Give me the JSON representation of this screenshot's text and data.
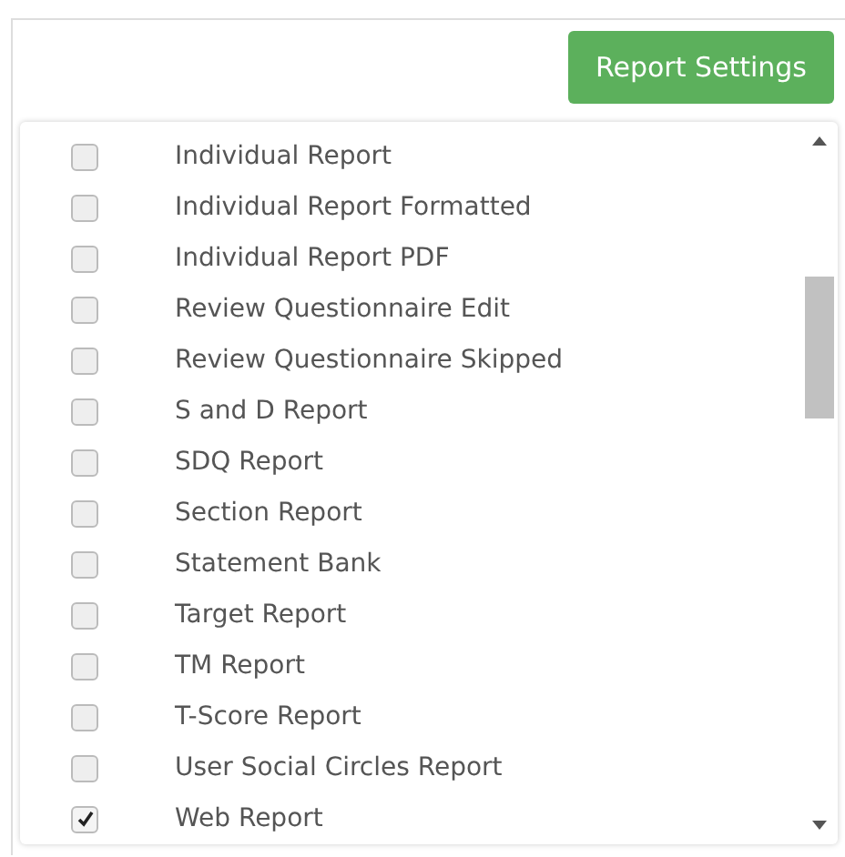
{
  "button": {
    "label": "Report Settings"
  },
  "items": [
    {
      "label": "Individual Report",
      "checked": false
    },
    {
      "label": "Individual Report Formatted",
      "checked": false
    },
    {
      "label": "Individual Report PDF",
      "checked": false
    },
    {
      "label": "Review Questionnaire Edit",
      "checked": false
    },
    {
      "label": "Review Questionnaire Skipped",
      "checked": false
    },
    {
      "label": "S and D Report",
      "checked": false
    },
    {
      "label": "SDQ Report",
      "checked": false
    },
    {
      "label": "Section Report",
      "checked": false
    },
    {
      "label": "Statement Bank",
      "checked": false
    },
    {
      "label": "Target Report",
      "checked": false
    },
    {
      "label": "TM Report",
      "checked": false
    },
    {
      "label": "T-Score Report",
      "checked": false
    },
    {
      "label": "User Social Circles Report",
      "checked": false
    },
    {
      "label": "Web Report",
      "checked": true
    }
  ]
}
